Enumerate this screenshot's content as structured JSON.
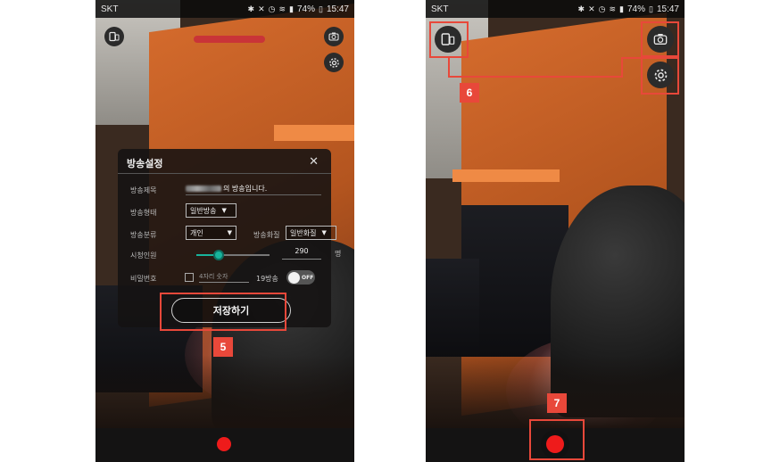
{
  "left_screen": {
    "status_bar": {
      "carrier": "SKT",
      "battery": "74%",
      "time": "15:47"
    },
    "settings_panel": {
      "title": "방송설정",
      "close_icon": "close-icon",
      "title_label": "방송제목",
      "title_value_suffix": "의 방송입니다.",
      "type_label": "방송형태",
      "type_value": "일반방송",
      "category_label": "방송분류",
      "category_value": "개인",
      "quality_label": "방송화질",
      "quality_value": "일반화질",
      "viewers_label": "시청인원",
      "viewers_value": "290",
      "viewers_unit": "명",
      "viewers_slider_fraction": 0.3,
      "password_label": "비밀번호",
      "password_placeholder": "4자리 숫자",
      "age_label": "19방송",
      "age_toggle_text": "OFF",
      "save_label": "저장하기"
    },
    "annotation_badge": "5"
  },
  "right_screen": {
    "status_bar": {
      "carrier": "SKT",
      "battery": "74%",
      "time": "15:47"
    },
    "annotation_badge_top": "6",
    "annotation_badge_bottom": "7"
  },
  "colors": {
    "highlight": "#e8483a",
    "record": "#ee1b1b",
    "slider": "#18b39b"
  }
}
